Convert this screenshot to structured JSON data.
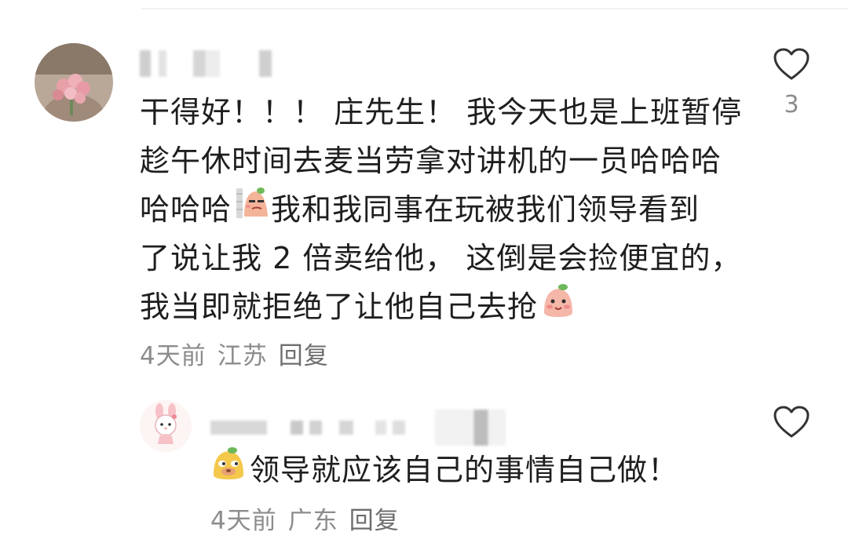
{
  "comments": [
    {
      "username": "",
      "lines": [
        "干得好！！！ 庄先生！ 我今天也是上班暂停",
        "趁午休时间去麦当劳拿对讲机的一员哈哈哈",
        "哈哈哈",
        "我和我同事在玩被我们领导看到",
        "了说让我 2 倍卖给他， 这倒是会捡便宜的，",
        "我当即就拒绝了让他自己去抢"
      ],
      "meta": {
        "time": "4天前",
        "location": "江苏",
        "reply": "回复"
      },
      "like_count": "3"
    },
    {
      "username": "",
      "text": "领导就应该自己的事情自己做！",
      "meta": {
        "time": "4天前",
        "location": "广东",
        "reply": "回复"
      }
    }
  ],
  "icons": {
    "like": "heart-outline-icon",
    "emoji_sly": "sly-face-emoji-icon",
    "emoji_shy": "shy-face-emoji-icon",
    "emoji_sneaky": "sneaky-face-emoji-icon"
  },
  "colors": {
    "text": "#1e1e1e",
    "meta": "#8c8c8c",
    "background": "#ffffff"
  }
}
